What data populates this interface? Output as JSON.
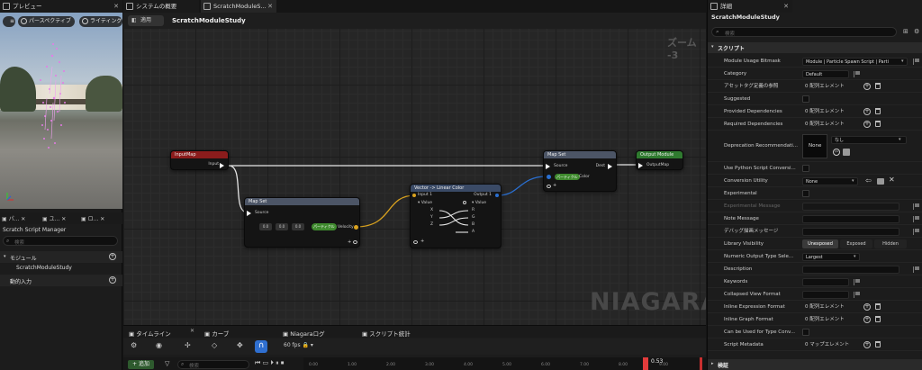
{
  "tabs": {
    "preview": "プレビュー",
    "overview": "システムの概要",
    "scratch": "ScratchModuleS...",
    "details": "詳細"
  },
  "viewport": {
    "perspective": "パースペクティブ",
    "lighting": "ライティング"
  },
  "left_panel": {
    "subtabs": [
      "パ...",
      "ユ...",
      "ロ..."
    ],
    "title": "Scratch Script Manager",
    "search_placeholder": "検索",
    "module_header": "モジュール",
    "module_item": "ScratchModuleStudy",
    "dynamic_input": "動的入力"
  },
  "graph_toolbar": {
    "apply": "適用",
    "title": "ScratchModuleStudy",
    "zoom": "ズーム -3"
  },
  "watermark": "NIAGARA",
  "nodes": {
    "input_map": {
      "title": "InputMap",
      "out_pin": "Input"
    },
    "map_set1": {
      "title": "Map Set",
      "source": "Source",
      "v1": "0.0",
      "v2": "0.0",
      "v3": "0.0",
      "param": "パーティクル",
      "param_name": "Velocity"
    },
    "vec2lin": {
      "title": "Vector -> Linear Color",
      "in_pin": "Input 1",
      "out_pin": "Output 1",
      "value_in": "Value",
      "value_out": "Value",
      "xs": [
        "X",
        "Y",
        "Z"
      ],
      "rs": [
        "R",
        "G",
        "B",
        "A"
      ]
    },
    "map_set2": {
      "title": "Map Set",
      "source": "Source",
      "dest": "Dest",
      "param": "パーティクル",
      "param_name": "Color"
    },
    "output": {
      "title": "Output Module",
      "pin": "OutputMap"
    }
  },
  "bottom": {
    "tabs": [
      "タイムライン",
      "カーブ",
      "Niagaraログ",
      "スクリプト統計"
    ],
    "fps": "60 fps",
    "add": "追加",
    "search_placeholder": "検索",
    "time_marker": "0.53",
    "ticks": [
      "0.00",
      "1.00",
      "2.00",
      "3.00",
      "4.00",
      "5.00",
      "6.00",
      "7.00",
      "8.00",
      "9.00"
    ]
  },
  "details": {
    "object_name": "ScratchModuleStudy",
    "search_placeholder": "検索",
    "section_script": "スクリプト",
    "section_bottom": "検証",
    "rows": [
      {
        "label": "Module Usage Bitmask",
        "value": "Module | Particle Spawn Script | Parti"
      },
      {
        "label": "Category",
        "value": "Default"
      },
      {
        "label": "アセットタグ定義の参照",
        "value": "0 配列エレメント"
      },
      {
        "label": "Suggested",
        "value": ""
      },
      {
        "label": "Provided Dependencies",
        "value": "0 配列エレメント"
      },
      {
        "label": "Required Dependencies",
        "value": "0 配列エレメント"
      },
      {
        "label": "Deprecation Recommendati...",
        "value": "None",
        "extra": "なし"
      },
      {
        "label": "Use Python Script Conversi...",
        "value": ""
      },
      {
        "label": "Conversion Utility",
        "value": "None"
      },
      {
        "label": "Experimental",
        "value": ""
      },
      {
        "label": "Experimental Message",
        "value": ""
      },
      {
        "label": "Note Message",
        "value": ""
      },
      {
        "label": "デバッグ描画メッセージ",
        "value": ""
      },
      {
        "label": "Library Visibility",
        "value": "Unexposed",
        "opt2": "Exposed",
        "opt3": "Hidden"
      },
      {
        "label": "Numeric Output Type Sele...",
        "value": "Largest"
      },
      {
        "label": "Description",
        "value": ""
      },
      {
        "label": "Keywords",
        "value": ""
      },
      {
        "label": "Collapsed View Format",
        "value": ""
      },
      {
        "label": "Inline Expression Format",
        "value": "0 配列エレメント"
      },
      {
        "label": "Inline Graph Format",
        "value": "0 配列エレメント"
      },
      {
        "label": "Can be Used for Type Conv...",
        "value": ""
      },
      {
        "label": "Script Metadata",
        "value": "0 マップエレメント"
      }
    ]
  },
  "colors": {
    "input_map": "#8b1c1c",
    "map_set": "#4c5566",
    "output": "#2f7a2f",
    "vec_header": "#3a4a66",
    "wire_white": "#e6e6e6",
    "wire_yellow": "#d9a21f",
    "wire_blue": "#2a6fd1",
    "accent": "#2f6fd0"
  }
}
